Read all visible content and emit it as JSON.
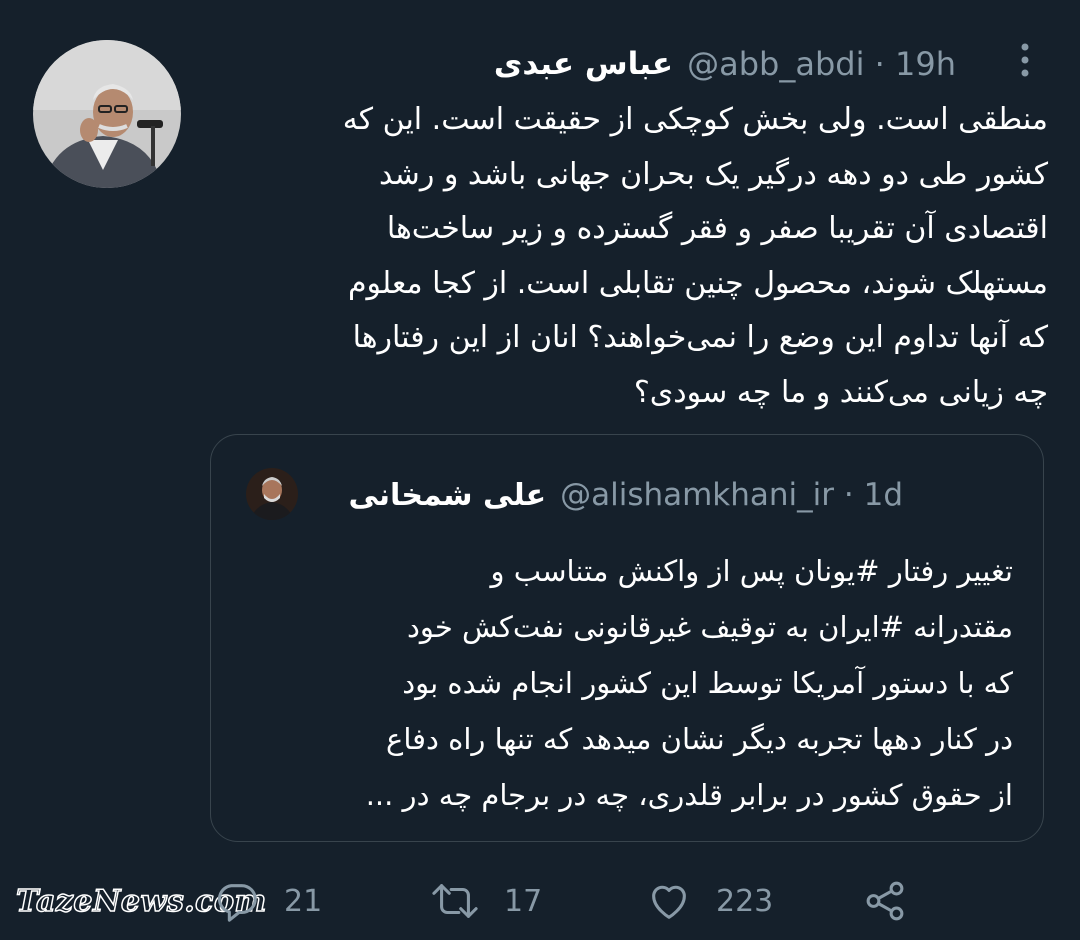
{
  "tweet": {
    "author_name": "عباس عبدی",
    "handle": "@abb_abdi",
    "time": "19h",
    "text_lines": [
      "منطقی است. ولی بخش کوچکی از حقیقت است. این که",
      "کشور طی دو دهه درگیر یک بحران جهانی باشد و رشد",
      "اقتصادی آن تقریبا صفر و فقر گسترده و زیر ساخت‌ها",
      "مستهلک شوند، محصول چنین تقابلی است. از کجا معلوم",
      "که آنها تداوم این وضع را نمی‌خواهند؟ انان از این رفتارها",
      "چه زیانی می‌کنند و ما چه سودی؟"
    ]
  },
  "quoted_tweet": {
    "author_name": "علی شمخانی",
    "handle": "@alishamkhani_ir",
    "time": "1d",
    "text_lines": [
      "تغییر رفتار #یونان پس از واکنش متناسب و",
      "مقتدرانه #ایران به توقیف غیرقانونی نفت‌کش خود",
      "که با دستور آمریکا توسط این کشور انجام شده بود",
      "در کنار دهها تجربه دیگر نشان میدهد که تنها راه دفاع",
      "از حقوق کشور در برابر قلدری، چه در برجام چه در ..."
    ]
  },
  "actions": {
    "reply_count": "21",
    "retweet_count": "17",
    "like_count": "223"
  },
  "watermark": "TazeNews.com",
  "icons": {
    "more": "more-vertical-icon",
    "reply": "reply-icon",
    "retweet": "retweet-icon",
    "like": "heart-icon",
    "share": "share-icon"
  },
  "colors": {
    "background": "#15202b",
    "secondary_text": "#8899a6",
    "border": "#38444d",
    "text": "#ffffff"
  }
}
